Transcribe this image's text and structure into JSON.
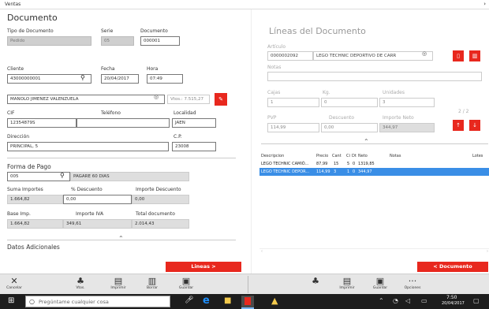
{
  "window": {
    "title": "Ventas"
  },
  "left": {
    "title": "Documento",
    "tipo_label": "Tipo de Documento",
    "tipo_value": "Pedido",
    "serie_label": "Serie",
    "serie_value": "05",
    "documento_label": "Documento",
    "documento_value": "000001",
    "cliente_label": "Cliente",
    "cliente_value": "43000000001",
    "fecha_label": "Fecha",
    "fecha_value": "20/04/2017",
    "hora_label": "Hora",
    "hora_value": "07:49",
    "nombre_value": "MANOLO JIMENEZ VALENZUELA",
    "vtos_value": "Vtos.: 7.515,27",
    "cif_label": "CIF",
    "cif_value": "12354879S",
    "telefono_label": "Teléfono",
    "telefono_value": "",
    "localidad_label": "Localidad",
    "localidad_value": "JAEN",
    "direccion_label": "Dirección",
    "direccion_value": "PRINCIPAL, 5",
    "cp_label": "C.P.",
    "cp_value": "23008",
    "pago_label": "Forma de Pago",
    "pago_code": "005",
    "pago_desc": "PAGARE 60 DIAS",
    "suma_label": "Suma Importes",
    "suma_value": "1.664,82",
    "descuento_label": "% Descuento",
    "descuento_value": "0,00",
    "impdesc_label": "Importe Descuento",
    "impdesc_value": "0,00",
    "base_label": "Base Imp.",
    "base_value": "1.664,82",
    "iva_label": "Importe IVA",
    "iva_value": "349,61",
    "total_label": "Total documento",
    "total_value": "2.014,43",
    "adicionales_label": "Datos Adicionales",
    "lineas_button": "Lineas >"
  },
  "right": {
    "title": "Líneas del Documento",
    "articulo_label": "Artículo",
    "articulo_code": "0000002092",
    "articulo_desc": "LEGO TECHNIC DEPORTIVO DE CARR",
    "notas_label": "Notas",
    "notas_value": "",
    "cajas_label": "Cajas",
    "cajas_value": "1",
    "kg_label": "Kg.",
    "kg_value": "0",
    "unidades_label": "Unidades",
    "unidades_value": "3",
    "pvp_label": "PVP",
    "pvp_value": "114,99",
    "desc_label": "Descuento",
    "desc_value": "0,00",
    "neto_label": "Importe Neto",
    "neto_value": "344,97",
    "pager": "2 / 2",
    "grid": {
      "headers": [
        "Descripcion",
        "Precio",
        "Cant",
        "Ci",
        "Dt",
        "Neto",
        "Notas",
        "Lotes"
      ],
      "rows": [
        [
          "LEGO TECHNIC CAMIÓ...",
          "87,99",
          "15",
          "5",
          "0",
          "1319,85",
          ""
        ],
        [
          "LEGO TECHNIC DEPOR...",
          "114,99",
          "3",
          "1",
          "0",
          "344,97",
          ""
        ]
      ]
    },
    "documento_button": "< Documento"
  },
  "toolbar": {
    "cancelar": "Cancelar",
    "vtos": "Vtos.",
    "imprimir": "Imprimir",
    "borrar": "Borrar",
    "guardar": "Guardar",
    "imprimir2": "Imprimir",
    "guardar2": "Guardar",
    "opciones": "Opciones"
  },
  "taskbar": {
    "search_placeholder": "Pregúntame cualquier cosa",
    "time": "7:50",
    "date": "20/04/2017"
  }
}
